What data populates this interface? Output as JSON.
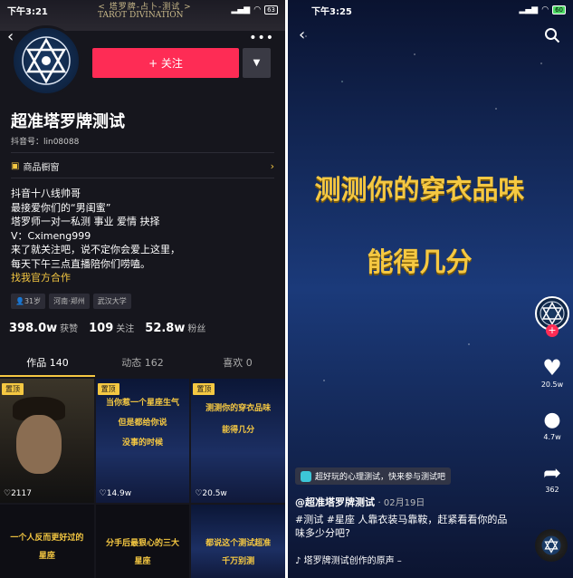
{
  "left": {
    "status": {
      "time": "下午3:21",
      "battery": "63"
    },
    "banner": {
      "title": "< 塔罗牌-占卜-测试 >",
      "subtitle": "TAROT DIVINATION"
    },
    "follow_label": "+ 关注",
    "name": "超准塔罗牌测试",
    "douyin_id": "抖音号：lin08088",
    "shop_label": "商品橱窗",
    "bio": [
      "抖音十八线帅哥",
      "最接爱你们的“男闺蜜”",
      "塔罗师一对一私测 事业 爱情 抉择",
      "V：Cximeng999",
      "来了就关注吧，说不定你会爱上这里，",
      "每天下午三点直播陪你们唠嗑。"
    ],
    "bio_link": "找我官方合作",
    "tags": [
      "31岁",
      "河南·郑州",
      "武汉大学"
    ],
    "stats": [
      {
        "value": "398.0w",
        "label": "获赞"
      },
      {
        "value": "109",
        "label": "关注"
      },
      {
        "value": "52.8w",
        "label": "粉丝"
      }
    ],
    "tabs": [
      "作品 140",
      "动态 162",
      "喜欢 0"
    ],
    "grid": [
      {
        "pinned": "置顶",
        "likes": "♡2117",
        "text": []
      },
      {
        "pinned": "置顶",
        "likes": "♡14.9w",
        "text": [
          "当你惹一个星座生气",
          "但是都给你说",
          "没事的时候"
        ]
      },
      {
        "pinned": "置顶",
        "likes": "♡20.5w",
        "text": [
          "测测你的穿衣品味",
          "能得几分"
        ]
      },
      {
        "pinned": "",
        "likes": "",
        "text": [
          "一个人反而更好过的",
          "星座"
        ]
      },
      {
        "pinned": "",
        "likes": "",
        "text": [
          "分手后最狠心的三大",
          "星座"
        ]
      },
      {
        "pinned": "",
        "likes": "",
        "text": [
          "都说这个测试超准",
          "千万别测"
        ]
      }
    ]
  },
  "right": {
    "status": {
      "time": "下午3:25",
      "battery": "60"
    },
    "title_line1": "测测你的穿衣品味",
    "title_line2": "能得几分",
    "likes": "20.5w",
    "comments": "4.7w",
    "shares": "362",
    "chip": "超好玩的心理测试，快来参与测试吧",
    "author": "@超准塔罗牌测试",
    "date": "· 02月19日",
    "caption": "#测试 #星座 人靠衣装马靠鞍，赶紧看看你的品味多少分吧?",
    "music": "塔罗牌测试创作的原声 –"
  },
  "colors": {
    "accent": "#fe2c55",
    "gold": "#f5c842",
    "bg": "#16161d"
  }
}
